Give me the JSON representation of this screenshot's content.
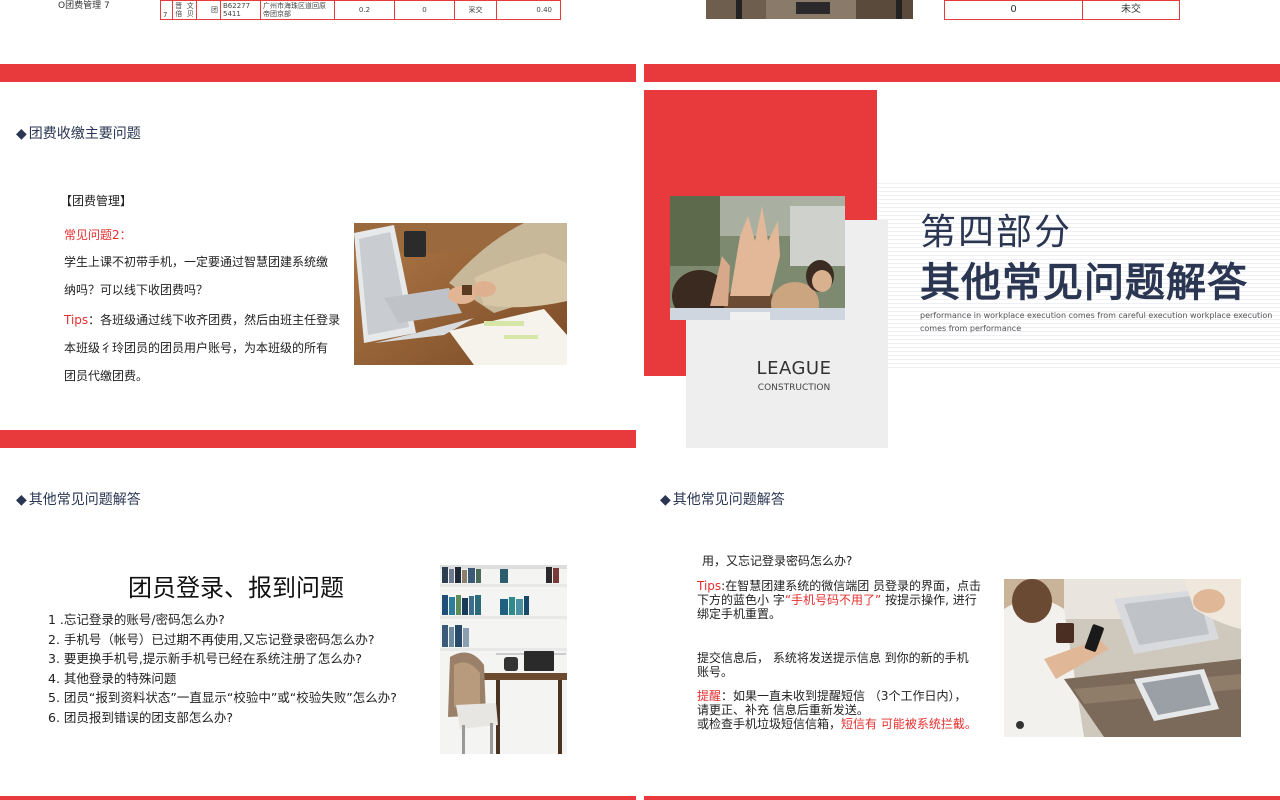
{
  "slide1": {
    "row_label": "O团费管理 7",
    "table_cells": [
      "7",
      "晋\n倍",
      "文\n贝",
      "团",
      "B62277\n5411",
      "广州市海珠区道回原\n帝团京部",
      "0.2",
      "0",
      "采交",
      "0.40"
    ]
  },
  "slide2": {
    "table_cells": [
      "0",
      "未交"
    ]
  },
  "slide3": {
    "section_title": "团费收缴主要问题",
    "tag": "【团费管理】",
    "question_label": "常见问题2：",
    "question_text_1": "学生上课不初带手机，一定要通过智慧团建系统缴",
    "question_text_2": "纳吗？可以线下收团费吗？",
    "tips_label": "Tips",
    "tips_text_1": "：各班级通过线下收齐团费，然后由班主任登录",
    "tips_text_2": "本班级彳玲团员的团员用户账号，为本班级的所有",
    "tips_text_3": "团员代缴团费。"
  },
  "slide4": {
    "part_title": "第四部分",
    "main_title": "其他常见问题解答",
    "subtitle_1": "performance in workplace execution comes from careful execution workplace execution",
    "subtitle_2": "comes from performance",
    "league": "LEAGUE",
    "construction": "CONSTRUCTION"
  },
  "slide5": {
    "section_title": "其他常见问题解答",
    "heading": "团员登录、报到问题",
    "items": [
      "1 .忘记登录的账号/密码怎么办?",
      "2. 手机号（帐号）已过期不再使用,又忘记登录密码怎么办?",
      "3. 要更换手机号,提示新手机号已经在系统注册了怎么办?",
      "4. 其他登录的特殊问题",
      "5. 团员“报到资料状态”一直显示“校验中”或“校验失败”怎么办?",
      "6. 团员报到错误的团支部怎么办?"
    ]
  },
  "slide6": {
    "section_title": "其他常见问题解答",
    "question": "用，又忘记登录密码怎么办?",
    "tips_label": "Tips",
    "tips_line1": ":在智慧团建系统的微信端团 员登录的界面，点击",
    "tips_line2a": "下方的蓝色小 字",
    "tips_highlight": "“手机号码不用了”",
    "tips_line2b": "  按提示操作, 进行",
    "tips_line3": "绑定手机重置。",
    "submit_line1": "提交信息后，  系统将发送提示信息 到你的新的手机",
    "submit_line2": "账号。",
    "remind_label": "提醒",
    "remind_line1": "：如果一直未收到提醒短信   （3个工作日内），",
    "remind_line2": "请更正、补充 信息后重新发送。",
    "remind_line3a": "或检查手机垃圾短信信箱，",
    "remind_highlight": "短信有 可能被系统拦截。"
  },
  "colors": {
    "accent_red": "#e8393c",
    "navy": "#2a3652",
    "panel_gray": "#eeeeee"
  }
}
